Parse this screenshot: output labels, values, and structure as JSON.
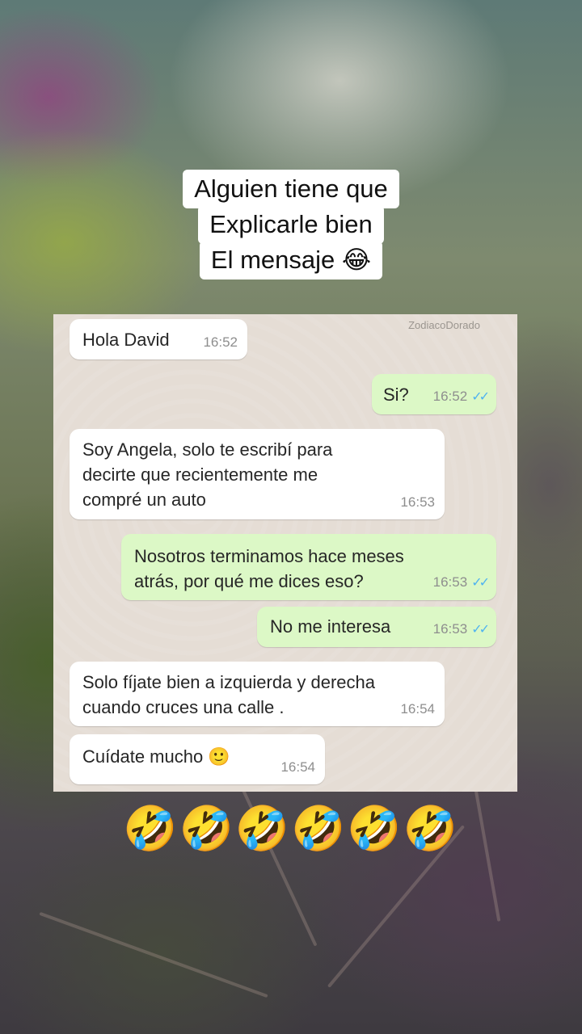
{
  "caption": {
    "lines": [
      "Alguien tiene que",
      "Explicarle bien",
      "El mensaje 😂"
    ]
  },
  "chat": {
    "watermark": "ZodiacoDorado",
    "messages": [
      {
        "direction": "in",
        "text": "Hola David",
        "time": "16:52",
        "ticks": ""
      },
      {
        "direction": "out",
        "text": "Si?",
        "time": "16:52",
        "ticks": "✓✓"
      },
      {
        "direction": "in",
        "text": "Soy Angela,  solo te escribí para\ndecirte que recientemente me\ncompré un auto",
        "time": "16:53",
        "ticks": ""
      },
      {
        "direction": "out",
        "text": "Nosotros terminamos hace meses\natrás, por qué me dices eso?",
        "time": "16:53",
        "ticks": "✓✓"
      },
      {
        "direction": "out",
        "text": "No me interesa",
        "time": "16:53",
        "ticks": "✓✓"
      },
      {
        "direction": "in",
        "text": "Solo fíjate bien a izquierda y derecha\ncuando cruces una calle .",
        "time": "16:54",
        "ticks": ""
      },
      {
        "direction": "in",
        "text": "Cuídate mucho 🙂",
        "time": "16:54",
        "ticks": ""
      }
    ]
  },
  "reaction": "🤣🤣🤣🤣🤣🤣",
  "colors": {
    "incoming_bubble": "#ffffff",
    "outgoing_bubble": "#dcf8c6",
    "read_ticks": "#4fb3f0",
    "chat_background": "#e5ddd5"
  }
}
